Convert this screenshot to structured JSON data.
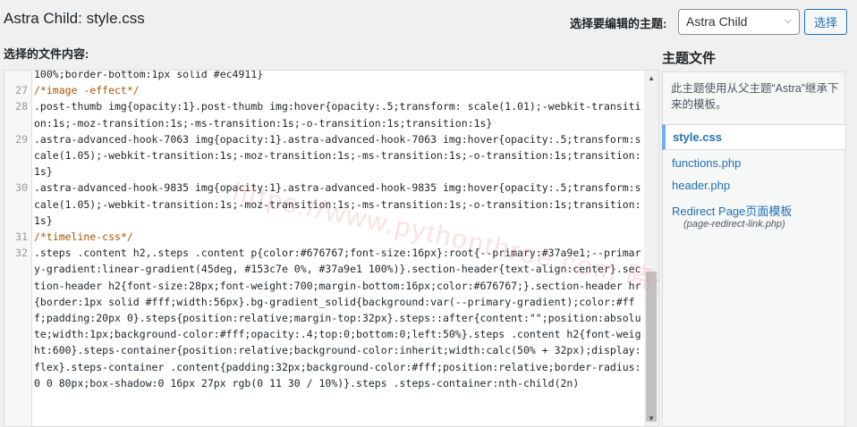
{
  "header": {
    "page_title": "Astra Child: style.css",
    "select_theme_label": "选择要编辑的主题:",
    "theme_select_value": "Astra Child",
    "select_button_label": "选择"
  },
  "editor": {
    "content_label": "选择的文件内容:",
    "lines": [
      {
        "num": "",
        "text": "100%;border-bottom:1px solid #ec4911}"
      },
      {
        "num": "27",
        "text": "/*image -effect*/"
      },
      {
        "num": "28",
        "text": ".post-thumb img{opacity:1}.post-thumb img:hover{opacity:.5;transform: scale(1.01);-webkit-transition:1s;-moz-transition:1s;-ms-transition:1s;-o-transition:1s;transition:1s}"
      },
      {
        "num": "29",
        "text": ".astra-advanced-hook-7063 img{opacity:1}.astra-advanced-hook-7063 img:hover{opacity:.5;transform:scale(1.05);-webkit-transition:1s;-moz-transition:1s;-ms-transition:1s;-o-transition:1s;transition:1s}"
      },
      {
        "num": "30",
        "text": ".astra-advanced-hook-9835 img{opacity:1}.astra-advanced-hook-9835 img:hover{opacity:.5;transform:scale(1.05);-webkit-transition:1s;-moz-transition:1s;-ms-transition:1s;-o-transition:1s;transition:1s}"
      },
      {
        "num": "31",
        "text": "/*timeline-css*/"
      },
      {
        "num": "32",
        "text": ".steps .content h2,.steps .content p{color:#676767;font-size:16px}:root{--primary:#37a9e1;--primary-gradient:linear-gradient(45deg, #153c7e 0%, #37a9e1 100%)}.section-header{text-align:center}.section-header h2{font-size:28px;font-weight:700;margin-bottom:16px;color:#676767;}.section-header hr{border:1px solid #fff;width:56px}.bg-gradient_solid{background:var(--primary-gradient);color:#fff;padding:20px 0}.steps{position:relative;margin-top:32px}.steps::after{content:\"\";position:absolute;width:1px;background-color:#fff;opacity:.4;top:0;bottom:0;left:50%}.steps .content h2{font-weight:600}.steps-container{position:relative;background-color:inherit;width:calc(50% + 32px);display:flex}.steps-container .content{padding:32px;background-color:#fff;position:relative;border-radius:0 0 80px;box-shadow:0 16px 27px rgb(0 11 30 / 10%)}.steps .steps-container:nth-child(2n)"
      }
    ],
    "watermark": "https://www.pythonthree.com 晓得博客"
  },
  "sidebar": {
    "title": "主题文件",
    "description": "此主题使用从父主题“Astra”继承下来的模板。",
    "active_file": "style.css",
    "files": [
      "functions.php",
      "header.php",
      "Redirect Page页面模板"
    ],
    "sub_file": "(page-redirect-link.php)"
  },
  "colors": {
    "accent": "#2271b1",
    "active_border": "#72aee6",
    "comment": "#aa5500"
  }
}
